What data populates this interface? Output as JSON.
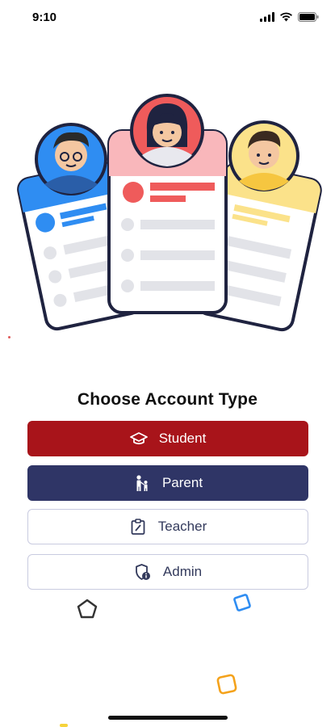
{
  "status_bar": {
    "time": "9:10",
    "icons": [
      "signal-icon",
      "wifi-icon",
      "battery-icon"
    ]
  },
  "hero": {
    "illustration": "account-type-cards",
    "card_colors": {
      "left": "#2f8df2",
      "center": "#f9b7bb",
      "right": "#fbe28a"
    }
  },
  "title": "Choose Account Type",
  "buttons": [
    {
      "label": "Student",
      "icon": "graduation-cap-icon",
      "bg": "#a8141a",
      "fg": "#ffffff"
    },
    {
      "label": "Parent",
      "icon": "parent-child-icon",
      "bg": "#2f3566",
      "fg": "#ffffff"
    },
    {
      "label": "Teacher",
      "icon": "clipboard-icon",
      "bg": "#ffffff",
      "fg": "#333a5c"
    },
    {
      "label": "Admin",
      "icon": "shield-info-icon",
      "bg": "#ffffff",
      "fg": "#333a5c"
    }
  ],
  "colors": {
    "accent_red": "#a8141a",
    "accent_navy": "#2f3566"
  }
}
